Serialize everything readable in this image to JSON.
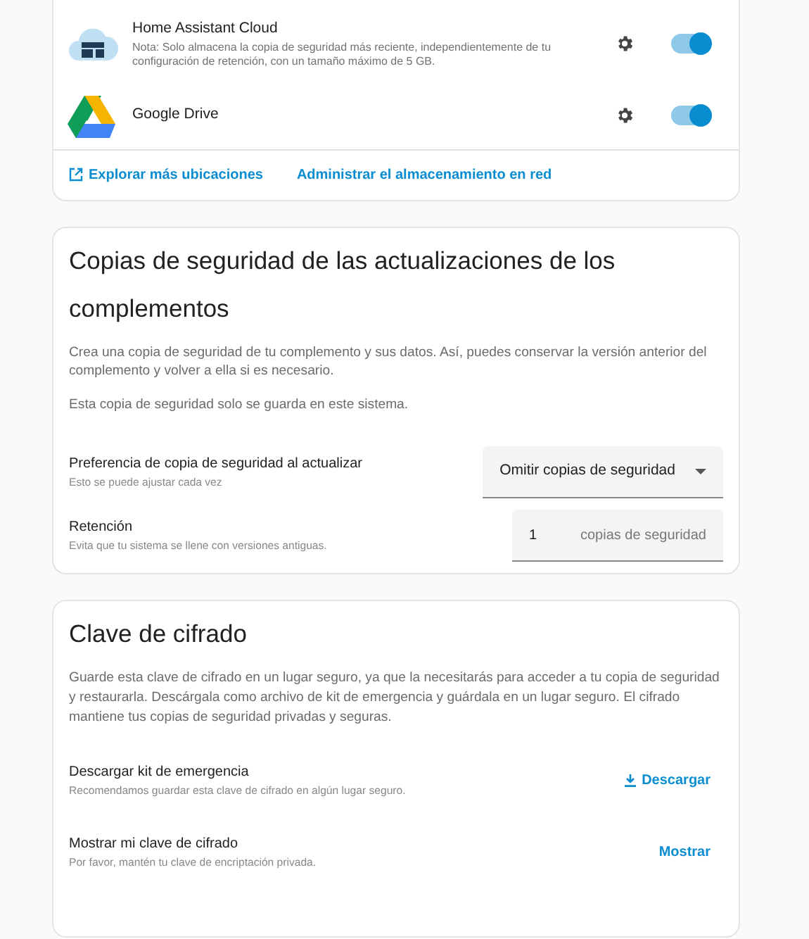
{
  "storage_locations": [
    {
      "kind": "cloud",
      "name": "Home Assistant Cloud",
      "note": "Nota: Solo almacena la copia de seguridad más reciente, independientemente de tu configuración de retención, con un tamaño máximo de 5 GB.",
      "enabled": true
    },
    {
      "kind": "drive",
      "name": "Google Drive",
      "enabled": true
    }
  ],
  "location_links": [
    {
      "label": "Explorar más ubicaciones",
      "external": true
    },
    {
      "label": "Administrar el almacenamiento en red",
      "external": false
    }
  ],
  "addon_card": {
    "title": "Copias de seguridad de las actualizaciones de los complementos",
    "paragraphs": [
      "Crea una copia de seguridad de tu complemento y sus datos. Así, puedes conservar la versión anterior del complemento y volver a ella si es necesario.",
      "Esta copia de seguridad solo se guarda en este sistema."
    ],
    "settings": [
      {
        "kind": "select",
        "label": "Preferencia de copia de seguridad al actualizar",
        "hint": "Esto se puede ajustar cada vez",
        "value": "Omitir copias de seguridad"
      },
      {
        "kind": "number",
        "label": "Retención",
        "hint": "Evita que tu sistema se llene con versiones antiguas.",
        "value": "1",
        "suffix": "copias de seguridad"
      }
    ]
  },
  "encryption_card": {
    "title": "Clave de cifrado",
    "paragraph": "Guarde esta clave de cifrado en un lugar seguro, ya que la necesitarás para acceder a tu copia de seguridad y restaurarla. Descárgala como archivo de kit de emergencia y guárdala en un lugar seguro. El cifrado mantiene tus copias de seguridad privadas y seguras.",
    "actions": [
      {
        "kind": "download",
        "label": "Descargar kit de emergencia",
        "hint": "Recomendamos guardar esta clave de cifrado en algún lugar seguro.",
        "button": "Descargar"
      },
      {
        "kind": "plain",
        "label": "Mostrar mi clave de cifrado",
        "hint": "Por favor, mantén tu clave de encriptación privada.",
        "button": "Mostrar"
      }
    ]
  }
}
